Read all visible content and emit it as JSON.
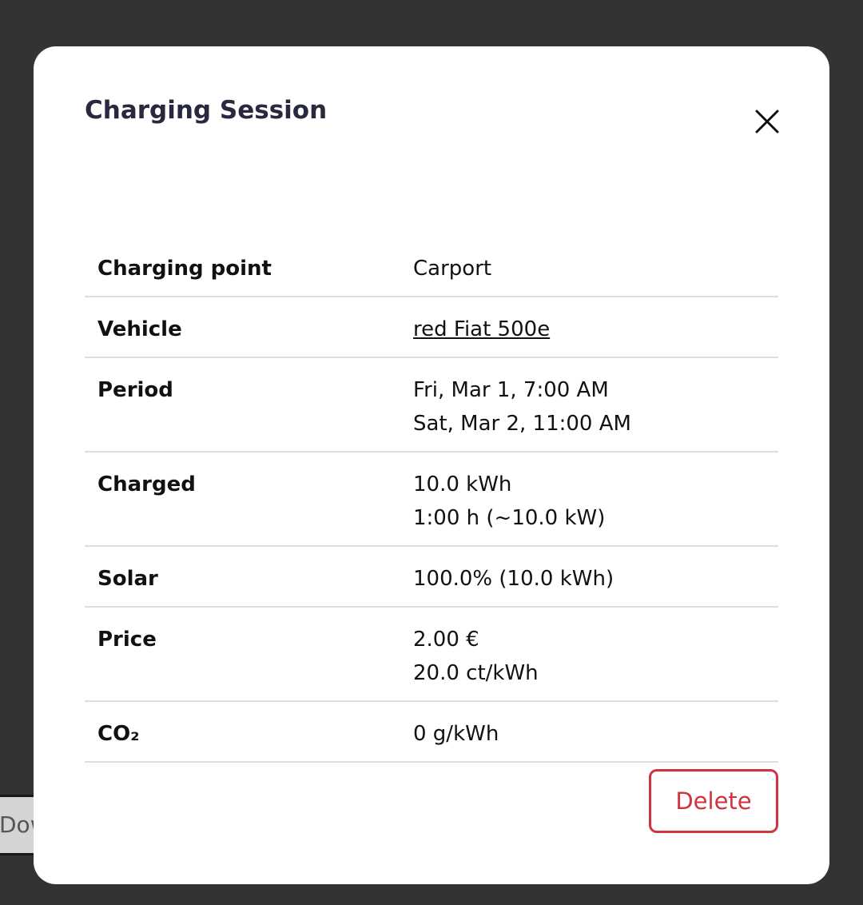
{
  "background": {
    "button_label": "Dow"
  },
  "modal": {
    "title": "Charging Session",
    "close_icon": "close-icon",
    "delete_label": "Delete"
  },
  "details": {
    "charging_point": {
      "label": "Charging point",
      "value": "Carport"
    },
    "vehicle": {
      "label": "Vehicle",
      "value": "red Fiat 500e"
    },
    "period": {
      "label": "Period",
      "start": "Fri, Mar 1, 7:00 AM",
      "end": "Sat, Mar 2, 11:00 AM"
    },
    "charged": {
      "label": "Charged",
      "energy": "10.0 kWh",
      "duration": "1:00 h (~10.0 kW)"
    },
    "solar": {
      "label": "Solar",
      "value": "100.0% (10.0 kWh)"
    },
    "price": {
      "label": "Price",
      "total": "2.00 €",
      "per_kwh": "20.0 ct/kWh"
    },
    "co2": {
      "label": "CO₂",
      "value": "0 g/kWh"
    }
  },
  "colors": {
    "overlay": "#333333",
    "title": "#28293e",
    "danger": "#d0343f",
    "divider": "#dedede"
  }
}
